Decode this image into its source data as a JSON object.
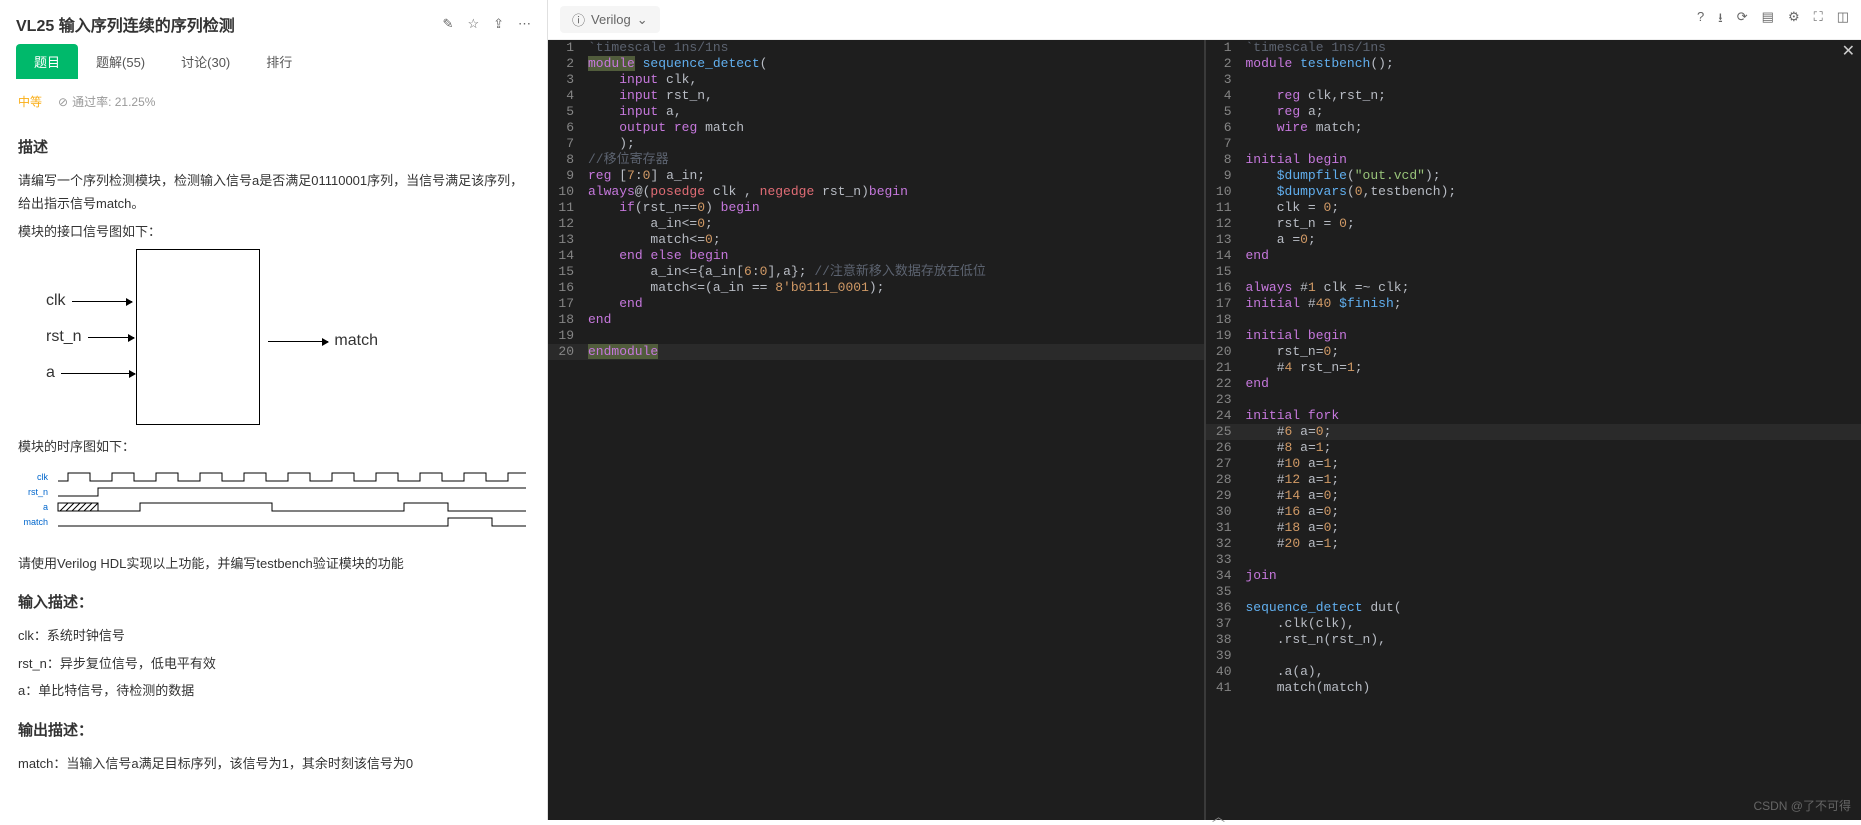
{
  "problem": {
    "title": "VL25 输入序列连续的序列检测",
    "tabs": [
      {
        "label": "题目",
        "active": true
      },
      {
        "label": "题解(55)"
      },
      {
        "label": "讨论(30)"
      },
      {
        "label": "排行"
      }
    ],
    "difficulty": "中等",
    "pass_rate_label": "通过率: 21.25%",
    "sections": {
      "desc_title": "描述",
      "desc_p1": "请编写一个序列检测模块，检测输入信号a是否满足01110001序列，当信号满足该序列，给出指示信号match。",
      "desc_p2": "模块的接口信号图如下：",
      "ports": {
        "clk": "clk",
        "rst_n": "rst_n",
        "a": "a",
        "match": "match"
      },
      "timing_hint": "模块的时序图如下：",
      "timing_labels": {
        "clk": "clk",
        "rst_n": "rst_n",
        "a": "a",
        "match": "match"
      },
      "impl_hint": "请使用Verilog HDL实现以上功能，并编写testbench验证模块的功能",
      "input_title": "输入描述：",
      "input_lines": [
        "clk：系统时钟信号",
        "rst_n：异步复位信号，低电平有效",
        "a：单比特信号，待检测的数据"
      ],
      "output_title": "输出描述：",
      "output_line": "match：当输入信号a满足目标序列，该信号为1，其余时刻该信号为0"
    }
  },
  "toolbar": {
    "language": "Verilog"
  },
  "editor_left": [
    {
      "n": 1,
      "html": "<span class='cmt'>`timescale 1ns/1ns</span>"
    },
    {
      "n": 2,
      "html": "<span class='kw hl'>module</span> <span class='fn'>sequence_detect</span><span class='plain'>(</span>"
    },
    {
      "n": 3,
      "html": "    <span class='kw'>input</span> <span class='plain'>clk,</span>"
    },
    {
      "n": 4,
      "html": "    <span class='kw'>input</span> <span class='plain'>rst_n,</span>"
    },
    {
      "n": 5,
      "html": "    <span class='kw'>input</span> <span class='plain'>a,</span>"
    },
    {
      "n": 6,
      "html": "    <span class='kw'>output</span> <span class='kw'>reg</span> <span class='plain'>match</span>"
    },
    {
      "n": 7,
      "html": "    <span class='plain'>);</span>"
    },
    {
      "n": 8,
      "html": "<span class='cmt'>//移位寄存器</span>"
    },
    {
      "n": 9,
      "html": "<span class='kw'>reg</span> <span class='plain'>[</span><span class='num'>7</span><span class='plain'>:</span><span class='num'>0</span><span class='plain'>] a_in;</span>"
    },
    {
      "n": 10,
      "html": "<span class='kw'>always</span><span class='plain'>@(</span><span class='kw2'>posedge</span> <span class='plain'>clk , </span><span class='kw2'>negedge</span> <span class='plain'>rst_n)</span><span class='kw'>begin</span>"
    },
    {
      "n": 11,
      "html": "    <span class='kw'>if</span><span class='plain'>(rst_n==</span><span class='num'>0</span><span class='plain'>) </span><span class='kw'>begin</span>"
    },
    {
      "n": 12,
      "html": "        <span class='plain'>a_in&lt;=</span><span class='num'>0</span><span class='plain'>;</span>"
    },
    {
      "n": 13,
      "html": "        <span class='plain'>match&lt;=</span><span class='num'>0</span><span class='plain'>;</span>"
    },
    {
      "n": 14,
      "html": "    <span class='kw'>end</span> <span class='kw'>else</span> <span class='kw'>begin</span>"
    },
    {
      "n": 15,
      "html": "        <span class='plain'>a_in&lt;={a_in[</span><span class='num'>6</span><span class='plain'>:</span><span class='num'>0</span><span class='plain'>],a};</span> <span class='cmt'>//注意新移入数据存放在低位</span>"
    },
    {
      "n": 16,
      "html": "        <span class='plain'>match&lt;=(a_in == </span><span class='num'>8'b0111_0001</span><span class='plain'>);</span>"
    },
    {
      "n": 17,
      "html": "    <span class='kw'>end</span>"
    },
    {
      "n": 18,
      "html": "<span class='kw'>end</span>"
    },
    {
      "n": 19,
      "html": ""
    },
    {
      "n": 20,
      "html": "<span class='kw hl'>endmodule</span>",
      "active": true
    }
  ],
  "editor_right": [
    {
      "n": 1,
      "html": "<span class='cmt'>`timescale 1ns/1ns</span>"
    },
    {
      "n": 2,
      "html": "<span class='kw'>module</span> <span class='fn'>testbench</span><span class='plain'>();</span>"
    },
    {
      "n": 3,
      "html": ""
    },
    {
      "n": 4,
      "html": "    <span class='kw'>reg</span> <span class='plain'>clk,rst_n;</span>"
    },
    {
      "n": 5,
      "html": "    <span class='kw'>reg</span> <span class='plain'>a;</span>"
    },
    {
      "n": 6,
      "html": "    <span class='kw'>wire</span> <span class='plain'>match;</span>"
    },
    {
      "n": 7,
      "html": ""
    },
    {
      "n": 8,
      "html": "<span class='kw'>initial</span> <span class='kw'>begin</span>"
    },
    {
      "n": 9,
      "html": "    <span class='fn'>$dumpfile</span><span class='plain'>(</span><span class='str'>\"out.vcd\"</span><span class='plain'>);</span>"
    },
    {
      "n": 10,
      "html": "    <span class='fn'>$dumpvars</span><span class='plain'>(</span><span class='num'>0</span><span class='plain'>,testbench);</span>"
    },
    {
      "n": 11,
      "html": "    <span class='plain'>clk = </span><span class='num'>0</span><span class='plain'>;</span>"
    },
    {
      "n": 12,
      "html": "    <span class='plain'>rst_n = </span><span class='num'>0</span><span class='plain'>;</span>"
    },
    {
      "n": 13,
      "html": "    <span class='plain'>a =</span><span class='num'>0</span><span class='plain'>;</span>"
    },
    {
      "n": 14,
      "html": "<span class='kw'>end</span>"
    },
    {
      "n": 15,
      "html": ""
    },
    {
      "n": 16,
      "html": "<span class='kw'>always</span> <span class='plain'>#</span><span class='num'>1</span> <span class='plain'>clk =~ clk;</span>"
    },
    {
      "n": 17,
      "html": "<span class='kw'>initial</span> <span class='plain'>#</span><span class='num'>40</span> <span class='fn'>$finish</span><span class='plain'>;</span>"
    },
    {
      "n": 18,
      "html": ""
    },
    {
      "n": 19,
      "html": "<span class='kw'>initial</span> <span class='kw'>begin</span>"
    },
    {
      "n": 20,
      "html": "    <span class='plain'>rst_n=</span><span class='num'>0</span><span class='plain'>;</span>"
    },
    {
      "n": 21,
      "html": "    <span class='plain'>#</span><span class='num'>4</span> <span class='plain'>rst_n=</span><span class='num'>1</span><span class='plain'>;</span>"
    },
    {
      "n": 22,
      "html": "<span class='kw'>end</span>"
    },
    {
      "n": 23,
      "html": ""
    },
    {
      "n": 24,
      "html": "<span class='kw'>initial</span> <span class='kw'>fork</span>"
    },
    {
      "n": 25,
      "html": "    <span class='plain'>#</span><span class='num'>6</span> <span class='plain'>a=</span><span class='num'>0</span><span class='plain'>;</span>",
      "active": true
    },
    {
      "n": 26,
      "html": "    <span class='plain'>#</span><span class='num'>8</span> <span class='plain'>a=</span><span class='num'>1</span><span class='plain'>;</span>"
    },
    {
      "n": 27,
      "html": "    <span class='plain'>#</span><span class='num'>10</span> <span class='plain'>a=</span><span class='num'>1</span><span class='plain'>;</span>"
    },
    {
      "n": 28,
      "html": "    <span class='plain'>#</span><span class='num'>12</span> <span class='plain'>a=</span><span class='num'>1</span><span class='plain'>;</span>"
    },
    {
      "n": 29,
      "html": "    <span class='plain'>#</span><span class='num'>14</span> <span class='plain'>a=</span><span class='num'>0</span><span class='plain'>;</span>"
    },
    {
      "n": 30,
      "html": "    <span class='plain'>#</span><span class='num'>16</span> <span class='plain'>a=</span><span class='num'>0</span><span class='plain'>;</span>"
    },
    {
      "n": 31,
      "html": "    <span class='plain'>#</span><span class='num'>18</span> <span class='plain'>a=</span><span class='num'>0</span><span class='plain'>;</span>"
    },
    {
      "n": 32,
      "html": "    <span class='plain'>#</span><span class='num'>20</span> <span class='plain'>a=</span><span class='num'>1</span><span class='plain'>;</span>"
    },
    {
      "n": 33,
      "html": ""
    },
    {
      "n": 34,
      "html": "<span class='kw'>join</span>"
    },
    {
      "n": 35,
      "html": ""
    },
    {
      "n": 36,
      "html": "<span class='fn'>sequence_detect</span> <span class='plain'>dut(</span>"
    },
    {
      "n": 37,
      "html": "    <span class='plain'>.clk(clk),</span>"
    },
    {
      "n": 38,
      "html": "    <span class='plain'>.rst_n(rst_n),</span>"
    },
    {
      "n": 39,
      "html": ""
    },
    {
      "n": 40,
      "html": "    <span class='plain'>.a(a),</span>"
    },
    {
      "n": 41,
      "html": "    <span class='plain'>match(match)</span>"
    }
  ],
  "watermark": "CSDN @了不可得"
}
